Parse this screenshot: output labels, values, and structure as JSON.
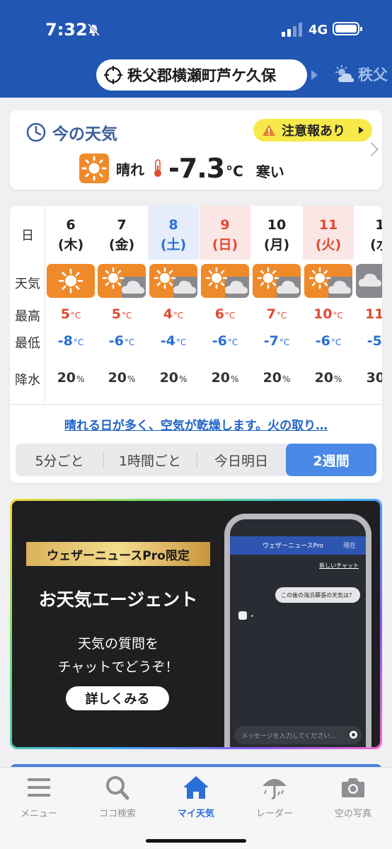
{
  "status_bar": {
    "time": "7:32",
    "network": "4G"
  },
  "location": {
    "name": "秩父郡横瀬町芦ケ久保",
    "next_name": "秩父"
  },
  "current": {
    "title": "今の天気",
    "alert_label": "注意報あり",
    "condition": "晴れ",
    "temperature": "-7.3",
    "unit": "°C",
    "feel": "寒い"
  },
  "forecast": {
    "row_labels": {
      "day": "日",
      "weather": "天気",
      "high": "最高",
      "low": "最低",
      "precip": "降水"
    },
    "days": [
      {
        "date": "6",
        "dow": "(木)",
        "icon": "sun-icon",
        "high": "5",
        "low": "-8",
        "precip": "20"
      },
      {
        "date": "7",
        "dow": "(金)",
        "icon": "sun-cloud-icon",
        "high": "5",
        "low": "-6",
        "precip": "20"
      },
      {
        "date": "8",
        "dow": "(土)",
        "icon": "sun-cloud-icon",
        "high": "4",
        "low": "-4",
        "precip": "20"
      },
      {
        "date": "9",
        "dow": "(日)",
        "icon": "sun-cloud-icon",
        "high": "6",
        "low": "-6",
        "precip": "20"
      },
      {
        "date": "10",
        "dow": "(月)",
        "icon": "sun-cloud-icon",
        "high": "7",
        "low": "-7",
        "precip": "20"
      },
      {
        "date": "11",
        "dow": "(火)",
        "icon": "sun-cloud-icon",
        "high": "10",
        "low": "-6",
        "precip": "20"
      },
      {
        "date": "1",
        "dow": "(水",
        "icon": "cloud-icon",
        "high": "11",
        "low": "-5",
        "precip": "30"
      }
    ],
    "temp_unit": "°C",
    "precip_unit": "%",
    "comment": "晴れる日が多く、空気が乾燥します。火の取り…",
    "tabs": [
      "5分ごと",
      "1時間ごと",
      "今日明日",
      "2週間"
    ],
    "active_tab": "2週間"
  },
  "promo": {
    "badge": "ウェザーニュースPro限定",
    "title": "お天気エージェント",
    "subtitle_line1": "天気の質問を",
    "subtitle_line2": "チャットでどうぞ！",
    "button": "詳しくみる",
    "phone_app_name": "ウェザーニュースPro",
    "phone_loc": "現在",
    "phone_new_chat": "新しいチャット",
    "phone_question": "この後の海浜幕張の天気は？",
    "phone_input_placeholder": "メッセージを入力してください..."
  },
  "tabbar": [
    {
      "label": "メニュー",
      "icon": "menu-icon"
    },
    {
      "label": "ココ検索",
      "icon": "search-icon"
    },
    {
      "label": "マイ天気",
      "icon": "home-icon"
    },
    {
      "label": "レーダー",
      "icon": "umbrella-icon"
    },
    {
      "label": "空の写真",
      "icon": "camera-icon"
    }
  ],
  "colors": {
    "brand_blue": "#2156b3",
    "accent_orange": "#ef8a2a",
    "alert_yellow": "#f7e94a",
    "active_tab_blue": "#4a8ae6"
  }
}
